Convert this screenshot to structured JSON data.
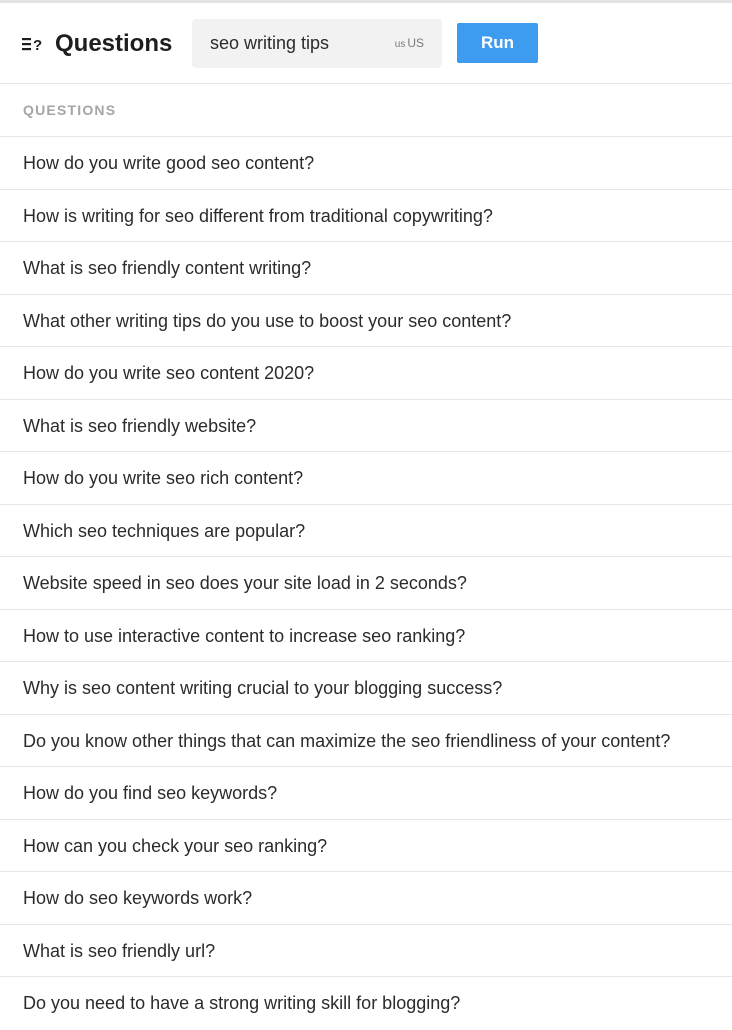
{
  "header": {
    "title": "Questions",
    "icon": "questions-list-icon"
  },
  "search": {
    "value": "seo writing tips",
    "locale_flag": "us",
    "locale_code": "US"
  },
  "run_button": {
    "label": "Run",
    "color": "#3d9cf0"
  },
  "section": {
    "heading": "QUESTIONS"
  },
  "questions": [
    "How do you write good seo content?",
    "How is writing for seo different from traditional copywriting?",
    "What is seo friendly content writing?",
    "What other writing tips do you use to boost your seo content?",
    "How do you write seo content 2020?",
    "What is seo friendly website?",
    "How do you write seo rich content?",
    "Which seo techniques are popular?",
    "Website speed in seo does your site load in 2 seconds?",
    "How to use interactive content to increase seo ranking?",
    "Why is seo content writing crucial to your blogging success?",
    "Do you know other things that can maximize the seo friendliness of your content?",
    "How do you find seo keywords?",
    "How can you check your seo ranking?",
    "How do seo keywords work?",
    "What is seo friendly url?",
    "Do you need to have a strong writing skill for blogging?"
  ]
}
